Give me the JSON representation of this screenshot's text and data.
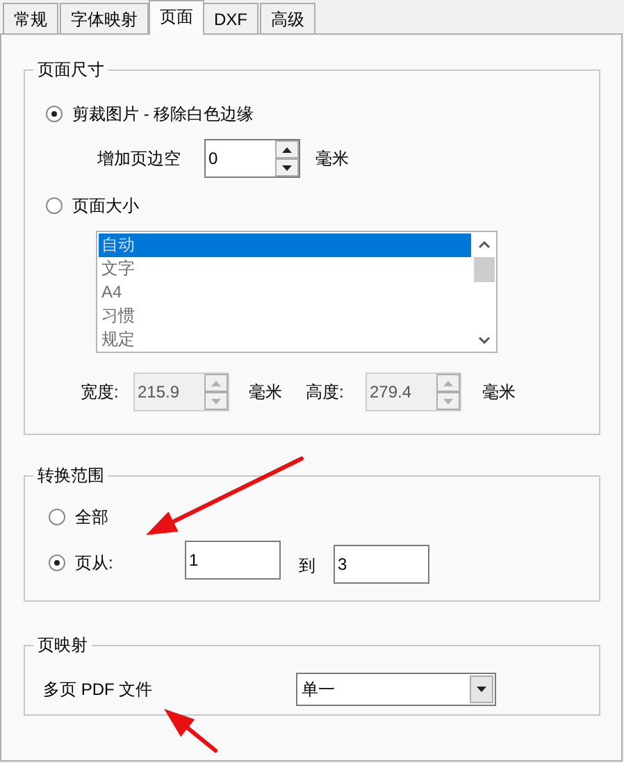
{
  "tabs": [
    {
      "label": "常规",
      "selected": false
    },
    {
      "label": "字体映射",
      "selected": false
    },
    {
      "label": "页面",
      "selected": true
    },
    {
      "label": "DXF",
      "selected": false
    },
    {
      "label": "高级",
      "selected": false
    }
  ],
  "page_size": {
    "title": "页面尺寸",
    "options": [
      {
        "label": "剪裁图片 - 移除白色边缘",
        "selected": true
      },
      {
        "label": "页面大小",
        "selected": false
      }
    ],
    "margin": {
      "label": "增加页边空",
      "value": "0",
      "unit": "毫米"
    },
    "size_list": {
      "disabled": true,
      "items": [
        {
          "label": "自动",
          "selected": true
        },
        {
          "label": "文字",
          "selected": false
        },
        {
          "label": "A4",
          "selected": false
        },
        {
          "label": "习惯",
          "selected": false
        },
        {
          "label": "规定",
          "selected": false
        }
      ]
    },
    "width": {
      "label": "宽度:",
      "value": "215.9",
      "unit": "毫米",
      "disabled": true
    },
    "height": {
      "label": "高度:",
      "value": "279.4",
      "unit": "毫米",
      "disabled": true
    }
  },
  "range": {
    "title": "转换范围",
    "options": [
      {
        "label": "全部",
        "selected": false
      },
      {
        "label": "页从:",
        "selected": true
      }
    ],
    "from": {
      "value": "1"
    },
    "to_label": "到",
    "to": {
      "value": "3"
    }
  },
  "page_mapping": {
    "title": "页映射",
    "label": "多页 PDF 文件",
    "select": {
      "value": "单一"
    }
  },
  "annotations": [
    {
      "kind": "arrow"
    },
    {
      "kind": "arrow"
    }
  ]
}
